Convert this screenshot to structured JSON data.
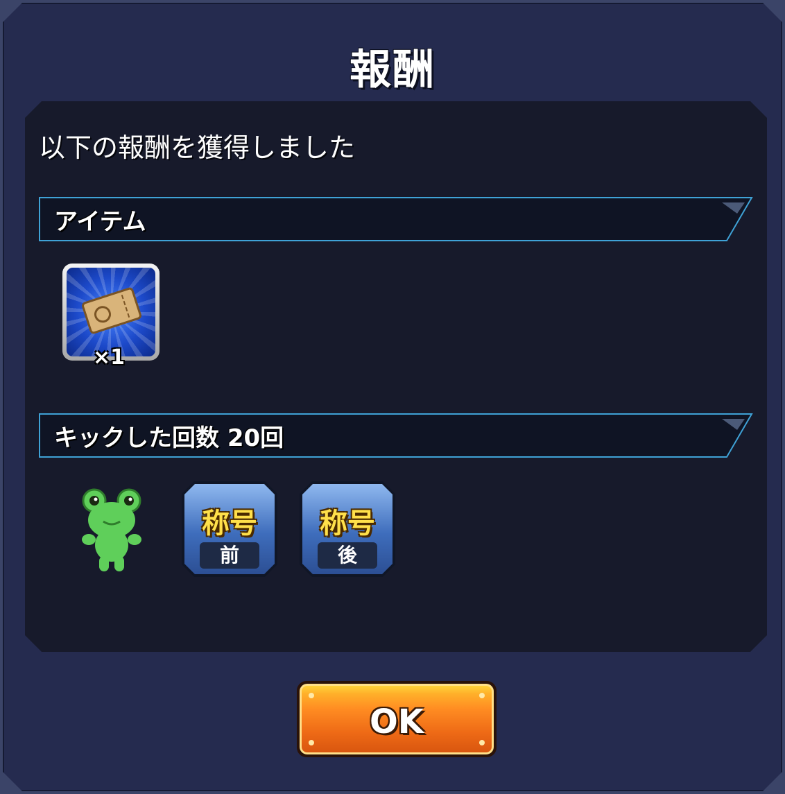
{
  "dialog": {
    "title": "報酬",
    "message": "以下の報酬を獲得しました"
  },
  "sections": [
    {
      "label": "アイテム",
      "items": [
        {
          "icon": "ticket-icon",
          "quantity": "×1"
        }
      ]
    },
    {
      "label": "キックした回数 20回",
      "items": [
        {
          "icon": "frog-icon"
        },
        {
          "icon": "title-badge-icon",
          "main": "称号",
          "sub": "前"
        },
        {
          "icon": "title-badge-icon",
          "main": "称号",
          "sub": "後"
        }
      ]
    }
  ],
  "footer": {
    "ok_label": "OK"
  },
  "colors": {
    "background": "#252b4f",
    "panel": "#171a2b",
    "section_bar_border": "#3fa2d6",
    "ok_button": "#ee6a16",
    "badge_text": "#ffe04a"
  }
}
